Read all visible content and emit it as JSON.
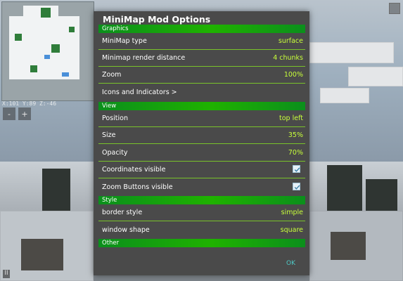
{
  "minimap": {
    "coords": "X:101 Y:89 Z:-46",
    "zoom_in_label": "+",
    "zoom_out_label": "-",
    "bottom_left_icon_label": "II"
  },
  "dialog": {
    "title": "MiniMap Mod Options",
    "sections": [
      {
        "label": "Graphics"
      },
      {
        "label": "View"
      },
      {
        "label": "Style"
      },
      {
        "label": "Other"
      }
    ],
    "rows": {
      "minimap_type": {
        "label": "MiniMap type",
        "value": "surface"
      },
      "render_distance": {
        "label": "Minimap render distance",
        "value": "4 chunks"
      },
      "zoom": {
        "label": "Zoom",
        "value": "100%"
      },
      "icons": {
        "label": "Icons and Indicators  >"
      },
      "position": {
        "label": "Position",
        "value": "top left"
      },
      "size": {
        "label": "Size",
        "value": "35%"
      },
      "opacity": {
        "label": "Opacity",
        "value": "70%"
      },
      "coordinates": {
        "label": "Coordinates visible",
        "checked": true
      },
      "zoom_buttons": {
        "label": "Zoom Buttons visible",
        "checked": true
      },
      "border_style": {
        "label": "border style",
        "value": "simple"
      },
      "window_shape": {
        "label": "window shape",
        "value": "square"
      }
    },
    "ok_label": "OK"
  },
  "colors": {
    "section_green": "#1fb200",
    "value_green": "#c8ff3a",
    "ok_cyan": "#4ec9c6",
    "dialog_bg": "#4a4a4a"
  }
}
